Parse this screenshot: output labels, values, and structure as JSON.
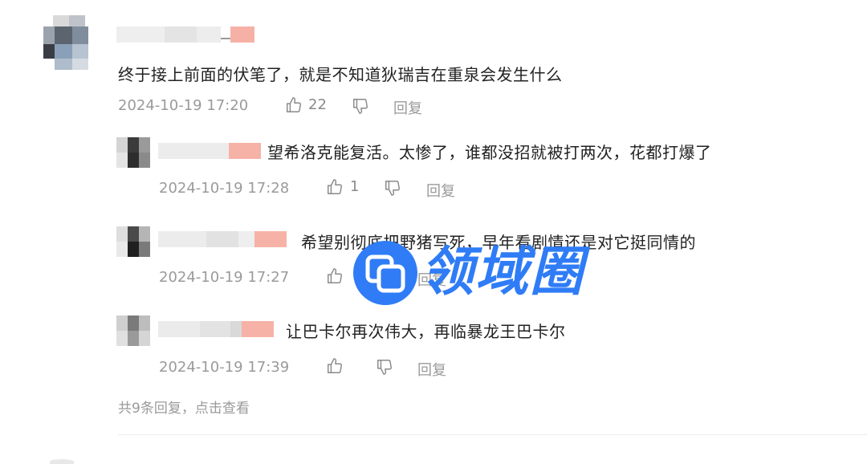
{
  "comment": {
    "text": "终于接上前面的伏笔了，就是不知道狄瑞吉在重泉会发生什么",
    "timestamp": "2024-10-19 17:20",
    "likes": "22",
    "reply_label": "回复"
  },
  "replies": [
    {
      "text": "望希洛克能复活。太惨了，谁都没招就被打两次，花都打爆了",
      "timestamp": "2024-10-19 17:28",
      "likes": "1",
      "reply_label": "回复"
    },
    {
      "text": "希望别彻底把野猪写死，早年看剧情还是对它挺同情的",
      "timestamp": "2024-10-19 17:27",
      "likes": "",
      "reply_label": "回复"
    },
    {
      "text": "让巴卡尔再次伟大，再临暴龙王巴卡尔",
      "timestamp": "2024-10-19 17:39",
      "likes": "",
      "reply_label": "回复"
    }
  ],
  "more_replies": "共9条回复，点击查看",
  "watermark": {
    "text": "领域圈",
    "color": "#2f7cf6"
  },
  "icons": {
    "like": "thumbs-up-icon",
    "dislike": "thumbs-down-icon"
  }
}
